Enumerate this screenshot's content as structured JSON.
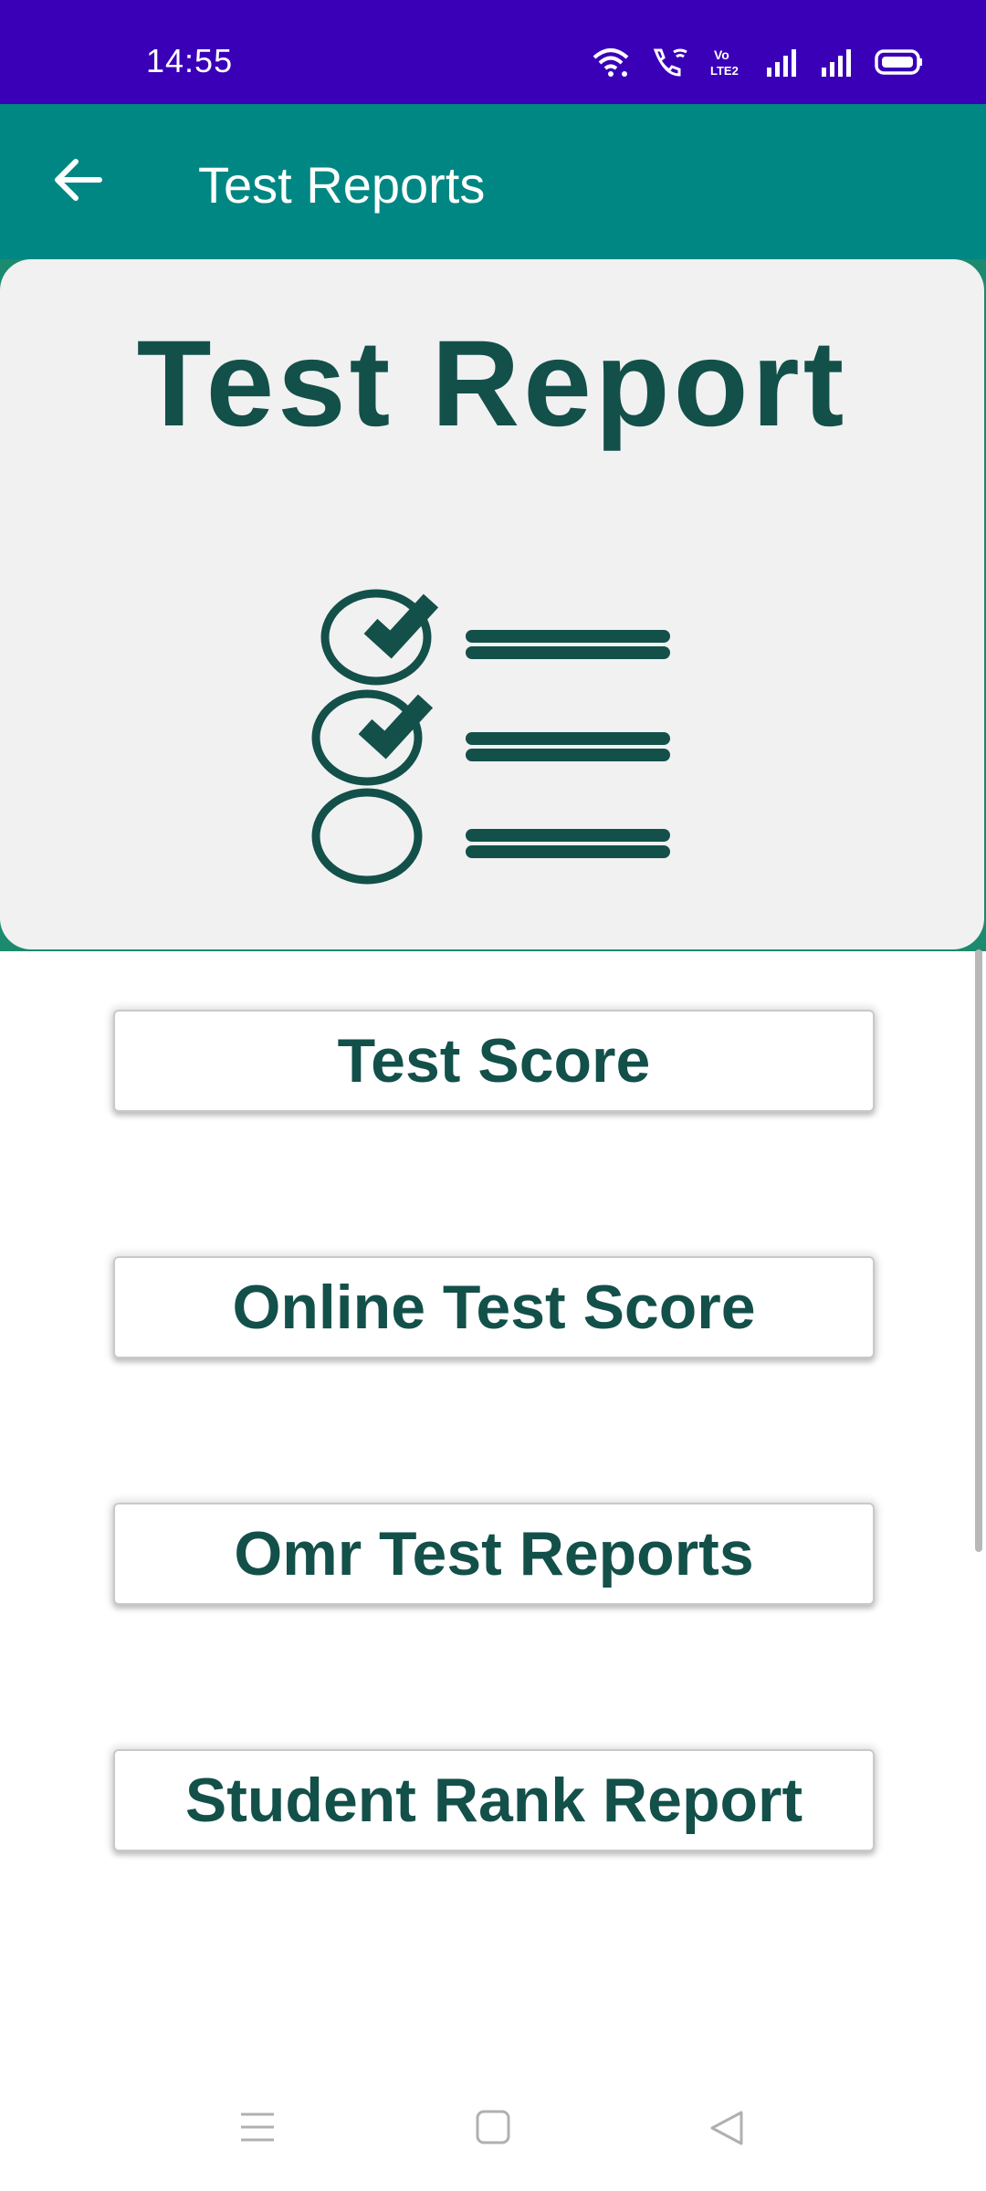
{
  "status_bar": {
    "time": "14:55",
    "icons": [
      "wifi-icon",
      "wifi-calling-icon",
      "volte-icon",
      "signal-icon",
      "signal-icon",
      "battery-icon"
    ],
    "volte_label": "Vo LTE2"
  },
  "app_bar": {
    "title": "Test Reports",
    "back_icon": "arrow-left-icon"
  },
  "hero": {
    "title": "Test Report",
    "icon": "checklist-icon"
  },
  "buttons": [
    {
      "label": "Test Score"
    },
    {
      "label": "Online Test Score"
    },
    {
      "label": "Omr Test Reports"
    },
    {
      "label": "Student Rank Report"
    }
  ],
  "nav_bar": {
    "icons": [
      "menu-icon",
      "home-icon",
      "back-triangle-icon"
    ]
  },
  "colors": {
    "status_bar": "#3a00b8",
    "app_bar": "#008784",
    "accent_text": "#13504a",
    "card_bg": "#f1f1f1"
  }
}
